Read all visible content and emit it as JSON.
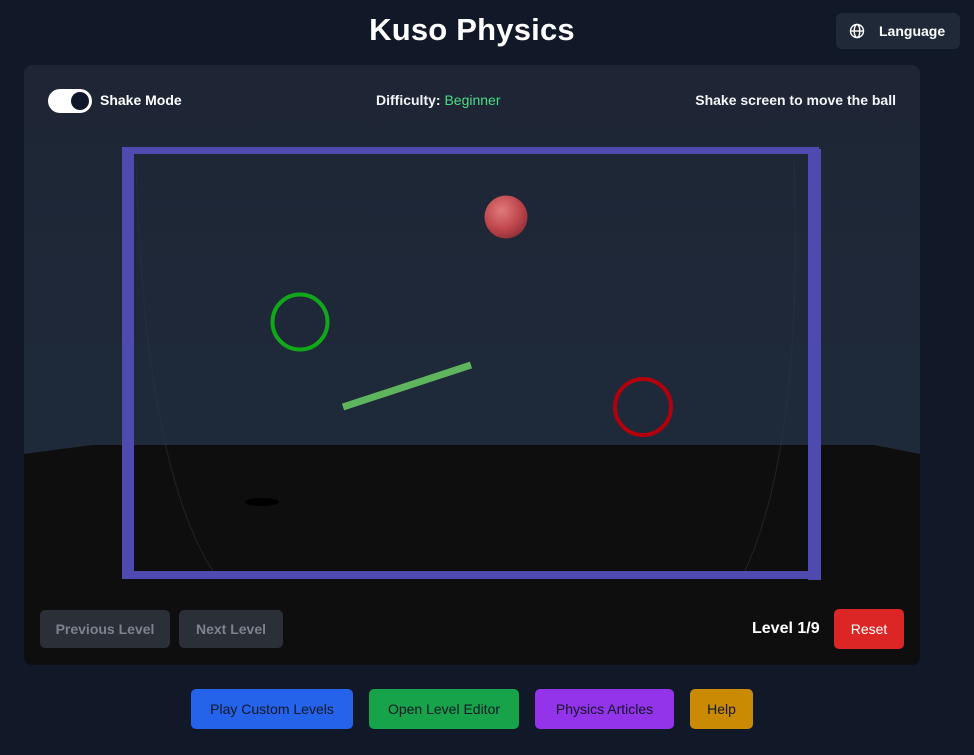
{
  "header": {
    "title": "Kuso Physics",
    "language_label": "Language",
    "language_icon": "globe-icon"
  },
  "game": {
    "shake_mode_label": "Shake Mode",
    "shake_mode_enabled": true,
    "difficulty_label": "Difficulty:",
    "difficulty_value": "Beginner",
    "hint": "Shake screen to move the ball",
    "previous_level_label": "Previous Level",
    "next_level_label": "Next Level",
    "level_indicator": "Level 1/9",
    "reset_label": "Reset"
  },
  "scene": {
    "objects": [
      "ball",
      "ball-shadow",
      "goal-ring",
      "hazard-ring",
      "platform-bar",
      "container-walls",
      "floor"
    ]
  },
  "footer": {
    "play_custom_label": "Play Custom Levels",
    "open_editor_label": "Open Level Editor",
    "articles_label": "Physics Articles",
    "help_label": "Help"
  },
  "colors": {
    "background": "#111827",
    "panel": "#1f2838",
    "accent_green": "#4ade80",
    "container": "#4f4ab0",
    "ball": "#c9555a",
    "goal_ring": "#10a818",
    "hazard_ring": "#b3000c",
    "platform": "#5fb55d",
    "reset": "#dc2626",
    "play_custom": "#2563eb",
    "open_editor": "#16a34a",
    "articles": "#9333ea",
    "help": "#ca8a04"
  }
}
